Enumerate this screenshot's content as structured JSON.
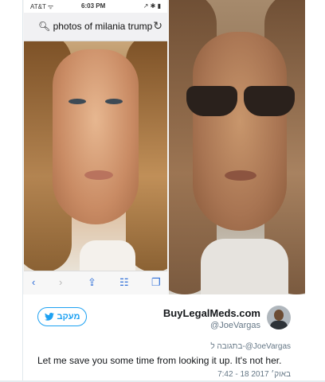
{
  "phone": {
    "carrier": "AT&T ᯤ",
    "time": "6:03 PM",
    "battery": "↗ ✱ ▮",
    "search_query": "photos of milania trump",
    "toolbar_icons": [
      "back-icon",
      "forward-icon",
      "share-icon",
      "bookmarks-icon",
      "tabs-icon"
    ]
  },
  "tweet": {
    "follow_label": "מעקב",
    "display_name": "BuyLegalMeds.com",
    "handle": "@JoeVargas",
    "reply_to": "בתגובה ל-@JoeVargas",
    "text": "Let me save you some time from looking it up. It's not her.",
    "timestamp": "7:42 - 18 באוק׳ 2017",
    "accent_color": "#1da1f2"
  }
}
